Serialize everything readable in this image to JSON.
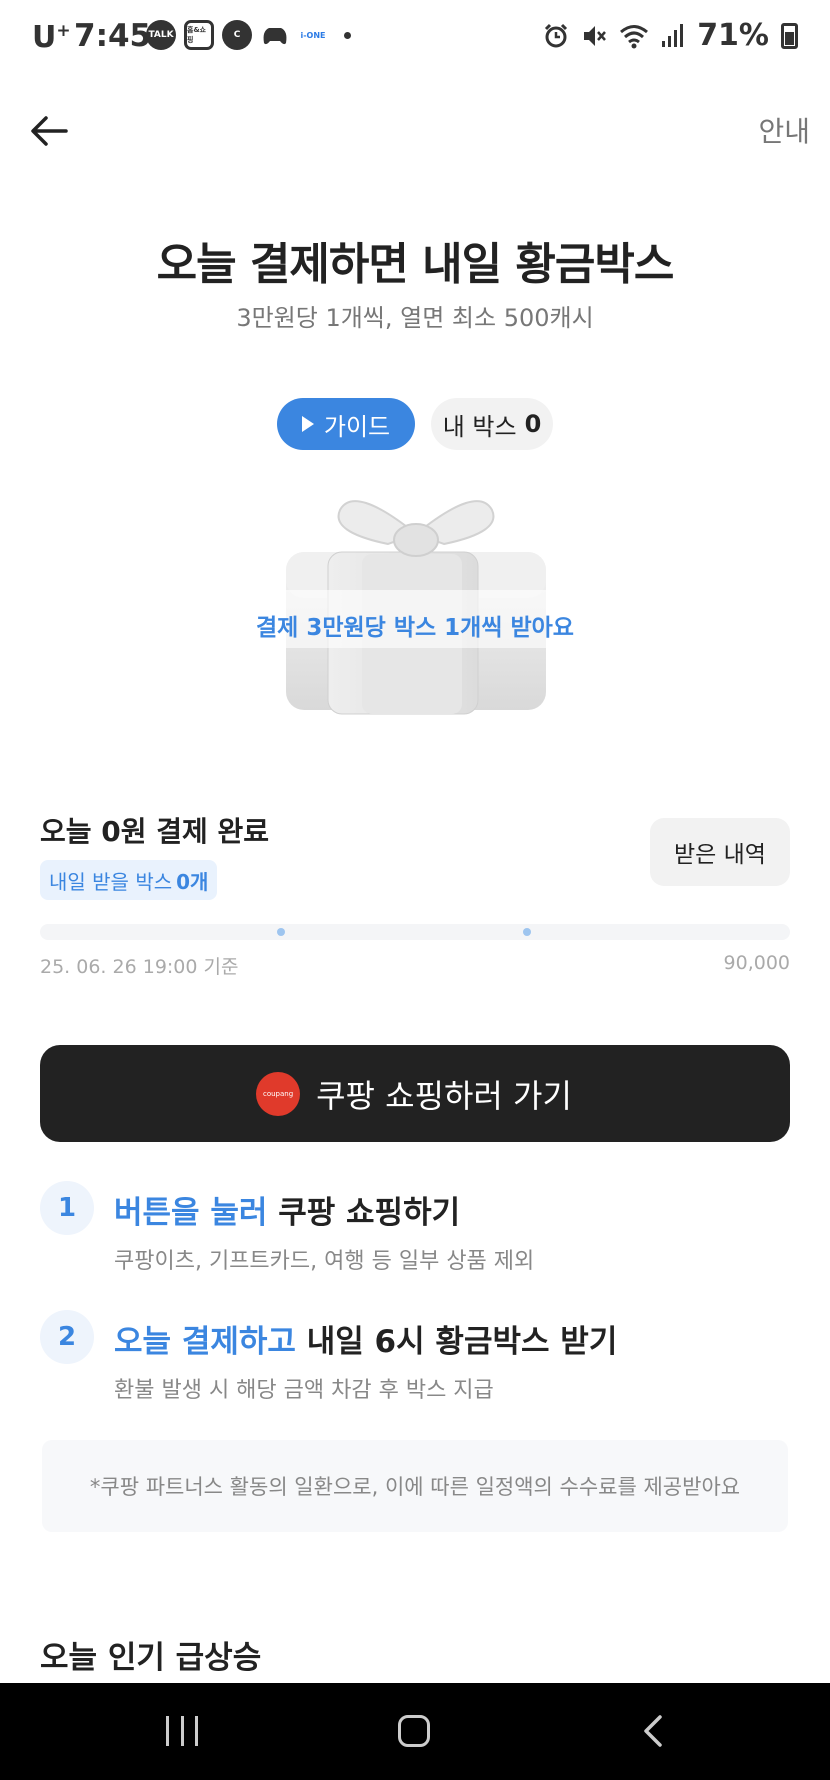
{
  "status_bar": {
    "carrier": "U",
    "carrier_plus": "+",
    "time": "7:45",
    "notif_icons": [
      "TALK",
      "홈&쇼핑",
      "C",
      "game-icon",
      "i-ONE"
    ],
    "battery": "71%"
  },
  "header": {
    "info_label": "안내"
  },
  "hero": {
    "title": "오늘 결제하면 내일 황금박스",
    "subtitle": "3만원당 1개씩, 열면 최소 500캐시",
    "guide_label": "가이드",
    "mybox_label": "내 박스",
    "mybox_count": "0",
    "box_caption": "결제 3만원당 박스 1개씩 받아요"
  },
  "payment": {
    "title": "오늘 0원 결제 완료",
    "badge_label": "내일 받을 박스",
    "badge_count": "0개",
    "history_button": "받은 내역",
    "progress_value": 0,
    "progress_max": 90000,
    "basis_text": "25. 06. 26 19:00 기준",
    "max_label": "90,000"
  },
  "cta": {
    "logo_text": "coupang",
    "label": "쿠팡 쇼핑하러 가기"
  },
  "steps": [
    {
      "num": "1",
      "highlight": "버튼을 눌러",
      "rest": " 쿠팡 쇼핑하기",
      "desc": "쿠팡이츠, 기프트카드, 여행 등 일부 상품 제외"
    },
    {
      "num": "2",
      "highlight": "오늘 결제하고",
      "rest": " 내일 6시 황금박스 받기",
      "desc": "환불 발생 시 해당 금액 차감 후 박스 지급"
    }
  ],
  "notice": "*쿠팡 파트너스 활동의 일환으로, 이에 따른 일정액의 수수료를 제공받아요",
  "section_title": "오늘 인기 급상승",
  "colors": {
    "accent": "#3b86e0",
    "cta_bg": "#222222",
    "coupang_red": "#e03a2b"
  }
}
